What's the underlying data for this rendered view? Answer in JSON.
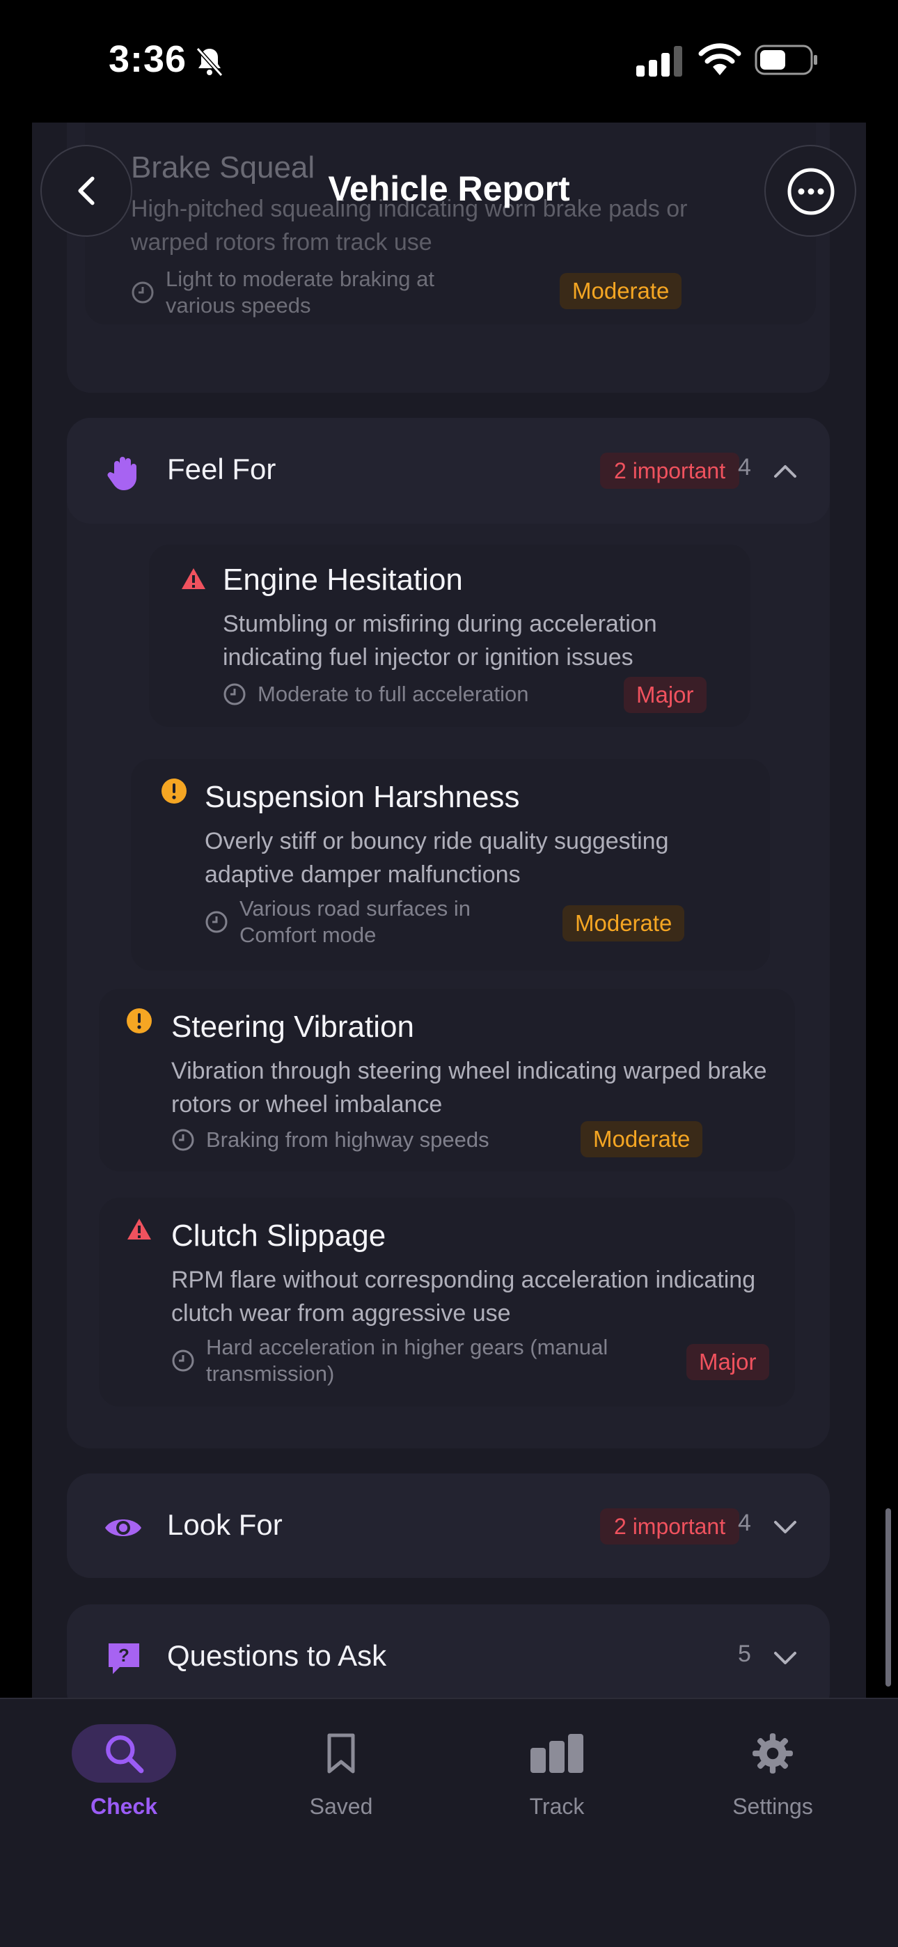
{
  "status": {
    "time": "3:36"
  },
  "nav": {
    "title": "Vehicle Report"
  },
  "previous_card": {
    "title": "Brake Squeal",
    "description": "High-pitched squealing indicating worn brake pads or warped rotors from track use",
    "condition": "Light to moderate braking at various speeds",
    "severity": "Moderate"
  },
  "feel_for": {
    "title": "Feel For",
    "important_badge": "2 important",
    "count": "4",
    "items": [
      {
        "title": "Engine Hesitation",
        "description": "Stumbling or misfiring during acceleration indicating fuel injector or ignition issues",
        "condition": "Moderate to full acceleration",
        "severity": "Major",
        "level": "major"
      },
      {
        "title": "Suspension Harshness",
        "description": "Overly stiff or bouncy ride quality suggesting adaptive damper malfunctions",
        "condition": "Various road surfaces in Comfort mode",
        "severity": "Moderate",
        "level": "moderate"
      },
      {
        "title": "Steering Vibration",
        "description": "Vibration through steering wheel indicating warped brake rotors or wheel imbalance",
        "condition": "Braking from highway speeds",
        "severity": "Moderate",
        "level": "moderate"
      },
      {
        "title": "Clutch Slippage",
        "description": "RPM flare without corresponding acceleration indicating clutch wear from aggressive use",
        "condition": "Hard acceleration in higher gears (manual transmission)",
        "severity": "Major",
        "level": "major"
      }
    ]
  },
  "look_for": {
    "title": "Look For",
    "important_badge": "2 important",
    "count": "4"
  },
  "questions": {
    "title": "Questions to Ask",
    "count": "5"
  },
  "tabs": [
    {
      "label": "Check",
      "icon": "search-icon",
      "active": true
    },
    {
      "label": "Saved",
      "icon": "bookmark-icon",
      "active": false
    },
    {
      "label": "Track",
      "icon": "bar-chart-icon",
      "active": false
    },
    {
      "label": "Settings",
      "icon": "gear-icon",
      "active": false
    }
  ],
  "colors": {
    "accent": "#9B5CF6",
    "major": "#F0525E",
    "moderate": "#F5A623",
    "background": "#1B1B25"
  }
}
